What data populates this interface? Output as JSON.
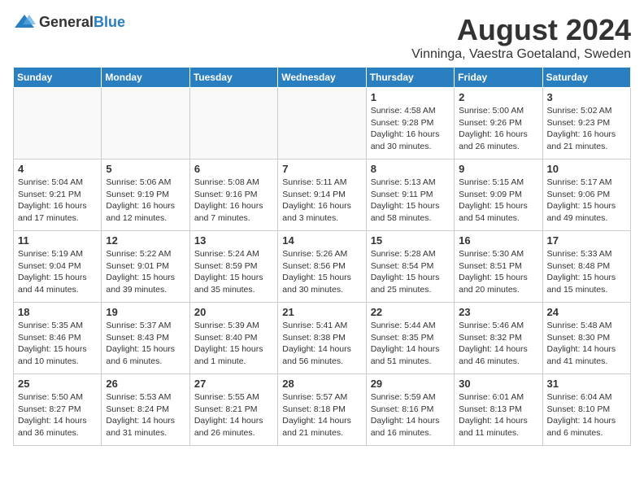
{
  "header": {
    "logo_general": "General",
    "logo_blue": "Blue",
    "month_year": "August 2024",
    "location": "Vinninga, Vaestra Goetaland, Sweden"
  },
  "days_of_week": [
    "Sunday",
    "Monday",
    "Tuesday",
    "Wednesday",
    "Thursday",
    "Friday",
    "Saturday"
  ],
  "weeks": [
    [
      {
        "day": "",
        "text": ""
      },
      {
        "day": "",
        "text": ""
      },
      {
        "day": "",
        "text": ""
      },
      {
        "day": "",
        "text": ""
      },
      {
        "day": "1",
        "text": "Sunrise: 4:58 AM\nSunset: 9:28 PM\nDaylight: 16 hours\nand 30 minutes."
      },
      {
        "day": "2",
        "text": "Sunrise: 5:00 AM\nSunset: 9:26 PM\nDaylight: 16 hours\nand 26 minutes."
      },
      {
        "day": "3",
        "text": "Sunrise: 5:02 AM\nSunset: 9:23 PM\nDaylight: 16 hours\nand 21 minutes."
      }
    ],
    [
      {
        "day": "4",
        "text": "Sunrise: 5:04 AM\nSunset: 9:21 PM\nDaylight: 16 hours\nand 17 minutes."
      },
      {
        "day": "5",
        "text": "Sunrise: 5:06 AM\nSunset: 9:19 PM\nDaylight: 16 hours\nand 12 minutes."
      },
      {
        "day": "6",
        "text": "Sunrise: 5:08 AM\nSunset: 9:16 PM\nDaylight: 16 hours\nand 7 minutes."
      },
      {
        "day": "7",
        "text": "Sunrise: 5:11 AM\nSunset: 9:14 PM\nDaylight: 16 hours\nand 3 minutes."
      },
      {
        "day": "8",
        "text": "Sunrise: 5:13 AM\nSunset: 9:11 PM\nDaylight: 15 hours\nand 58 minutes."
      },
      {
        "day": "9",
        "text": "Sunrise: 5:15 AM\nSunset: 9:09 PM\nDaylight: 15 hours\nand 54 minutes."
      },
      {
        "day": "10",
        "text": "Sunrise: 5:17 AM\nSunset: 9:06 PM\nDaylight: 15 hours\nand 49 minutes."
      }
    ],
    [
      {
        "day": "11",
        "text": "Sunrise: 5:19 AM\nSunset: 9:04 PM\nDaylight: 15 hours\nand 44 minutes."
      },
      {
        "day": "12",
        "text": "Sunrise: 5:22 AM\nSunset: 9:01 PM\nDaylight: 15 hours\nand 39 minutes."
      },
      {
        "day": "13",
        "text": "Sunrise: 5:24 AM\nSunset: 8:59 PM\nDaylight: 15 hours\nand 35 minutes."
      },
      {
        "day": "14",
        "text": "Sunrise: 5:26 AM\nSunset: 8:56 PM\nDaylight: 15 hours\nand 30 minutes."
      },
      {
        "day": "15",
        "text": "Sunrise: 5:28 AM\nSunset: 8:54 PM\nDaylight: 15 hours\nand 25 minutes."
      },
      {
        "day": "16",
        "text": "Sunrise: 5:30 AM\nSunset: 8:51 PM\nDaylight: 15 hours\nand 20 minutes."
      },
      {
        "day": "17",
        "text": "Sunrise: 5:33 AM\nSunset: 8:48 PM\nDaylight: 15 hours\nand 15 minutes."
      }
    ],
    [
      {
        "day": "18",
        "text": "Sunrise: 5:35 AM\nSunset: 8:46 PM\nDaylight: 15 hours\nand 10 minutes."
      },
      {
        "day": "19",
        "text": "Sunrise: 5:37 AM\nSunset: 8:43 PM\nDaylight: 15 hours\nand 6 minutes."
      },
      {
        "day": "20",
        "text": "Sunrise: 5:39 AM\nSunset: 8:40 PM\nDaylight: 15 hours\nand 1 minute."
      },
      {
        "day": "21",
        "text": "Sunrise: 5:41 AM\nSunset: 8:38 PM\nDaylight: 14 hours\nand 56 minutes."
      },
      {
        "day": "22",
        "text": "Sunrise: 5:44 AM\nSunset: 8:35 PM\nDaylight: 14 hours\nand 51 minutes."
      },
      {
        "day": "23",
        "text": "Sunrise: 5:46 AM\nSunset: 8:32 PM\nDaylight: 14 hours\nand 46 minutes."
      },
      {
        "day": "24",
        "text": "Sunrise: 5:48 AM\nSunset: 8:30 PM\nDaylight: 14 hours\nand 41 minutes."
      }
    ],
    [
      {
        "day": "25",
        "text": "Sunrise: 5:50 AM\nSunset: 8:27 PM\nDaylight: 14 hours\nand 36 minutes."
      },
      {
        "day": "26",
        "text": "Sunrise: 5:53 AM\nSunset: 8:24 PM\nDaylight: 14 hours\nand 31 minutes."
      },
      {
        "day": "27",
        "text": "Sunrise: 5:55 AM\nSunset: 8:21 PM\nDaylight: 14 hours\nand 26 minutes."
      },
      {
        "day": "28",
        "text": "Sunrise: 5:57 AM\nSunset: 8:18 PM\nDaylight: 14 hours\nand 21 minutes."
      },
      {
        "day": "29",
        "text": "Sunrise: 5:59 AM\nSunset: 8:16 PM\nDaylight: 14 hours\nand 16 minutes."
      },
      {
        "day": "30",
        "text": "Sunrise: 6:01 AM\nSunset: 8:13 PM\nDaylight: 14 hours\nand 11 minutes."
      },
      {
        "day": "31",
        "text": "Sunrise: 6:04 AM\nSunset: 8:10 PM\nDaylight: 14 hours\nand 6 minutes."
      }
    ]
  ]
}
